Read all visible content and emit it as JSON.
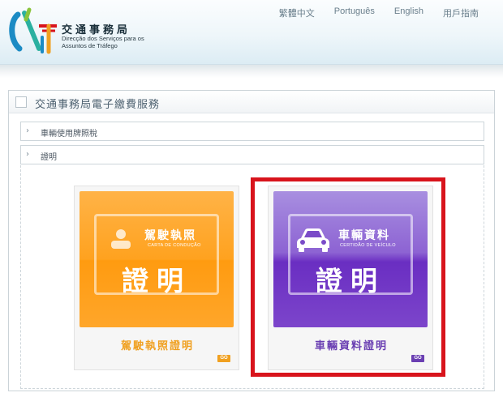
{
  "header": {
    "logo_cn": "交通事務局",
    "logo_pt": "Direcção dos Serviços para os Assuntos de Tráfego",
    "lang_links": [
      "繁體中文",
      "Português",
      "English",
      "用戶指南"
    ]
  },
  "panel": {
    "title": "交通事務局電子繳費服務",
    "accordion": [
      {
        "arrow": "›",
        "label": "車輛使用牌照稅"
      },
      {
        "arrow": "›",
        "label": "證明"
      }
    ]
  },
  "cards": [
    {
      "title": "駕駛執照",
      "subtitle": "CARTA DE CONDUÇÃO",
      "cert": "證明",
      "caption": "駕駛執照證明",
      "go": "GO",
      "icon": "person-icon",
      "caption_color": "#f0a020"
    },
    {
      "title": "車輛資料",
      "subtitle": "CERTIDÃO DE VEÍCULO",
      "cert": "證明",
      "caption": "車輛資料證明",
      "go": "GO",
      "icon": "car-icon",
      "caption_color": "#6a3fb2"
    }
  ],
  "colors": {
    "highlight": "#d8141c",
    "orange": "#ffa21f",
    "purple": "#7c45cb"
  }
}
